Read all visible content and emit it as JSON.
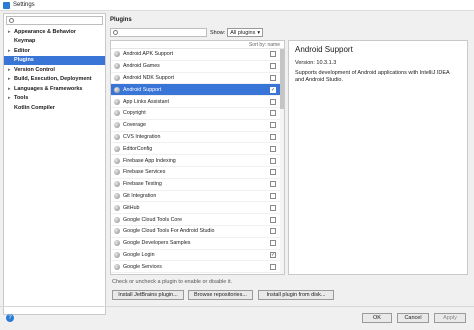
{
  "window": {
    "title": "Settings"
  },
  "sidebar": {
    "items": [
      {
        "label": "Appearance & Behavior",
        "arrow": "▸"
      },
      {
        "label": "Keymap",
        "arrow": ""
      },
      {
        "label": "Editor",
        "arrow": "▸"
      },
      {
        "label": "Plugins",
        "arrow": ""
      },
      {
        "label": "Version Control",
        "arrow": "▸"
      },
      {
        "label": "Build, Execution, Deployment",
        "arrow": "▸"
      },
      {
        "label": "Languages & Frameworks",
        "arrow": "▸"
      },
      {
        "label": "Tools",
        "arrow": "▸"
      },
      {
        "label": "Kotlin Compiler",
        "arrow": ""
      }
    ]
  },
  "main": {
    "title": "Plugins",
    "show_label": "Show:",
    "show_value": "All plugins",
    "sort_label": "Sort by: name",
    "plugins": [
      {
        "name": "Android APK Support",
        "checked": false
      },
      {
        "name": "Android Games",
        "checked": false
      },
      {
        "name": "Android NDK Support",
        "checked": false
      },
      {
        "name": "Android Support",
        "checked": true
      },
      {
        "name": "App Links Assistant",
        "checked": false
      },
      {
        "name": "Copyright",
        "checked": false
      },
      {
        "name": "Coverage",
        "checked": false
      },
      {
        "name": "CVS Integration",
        "checked": false
      },
      {
        "name": "EditorConfig",
        "checked": false
      },
      {
        "name": "Firebase App Indexing",
        "checked": false
      },
      {
        "name": "Firebase Services",
        "checked": false
      },
      {
        "name": "Firebase Testing",
        "checked": false
      },
      {
        "name": "Git Integration",
        "checked": false
      },
      {
        "name": "GitHub",
        "checked": false
      },
      {
        "name": "Google Cloud Tools Core",
        "checked": false
      },
      {
        "name": "Google Cloud Tools For Android Studio",
        "checked": false
      },
      {
        "name": "Google Developers Samples",
        "checked": false
      },
      {
        "name": "Google Login",
        "checked": true
      },
      {
        "name": "Google Services",
        "checked": false
      }
    ],
    "hint": "Check or uncheck a plugin to enable or disable it."
  },
  "detail": {
    "title": "Android Support",
    "version": "Version: 10.3.1.3",
    "description": "Supports development of Android applications with IntelliJ IDEA and Android Studio."
  },
  "buttons": {
    "install_jetbrains": "Install JetBrains plugin...",
    "browse_repos": "Browse repositories...",
    "install_disk": "Install plugin from disk...",
    "ok": "OK",
    "cancel": "Cancel",
    "apply": "Apply"
  },
  "icons": {
    "help": "help-icon",
    "search": "search-icon",
    "plugin": "plugin-icon",
    "app": "app-icon"
  },
  "colors": {
    "selection": "#3875d7"
  }
}
